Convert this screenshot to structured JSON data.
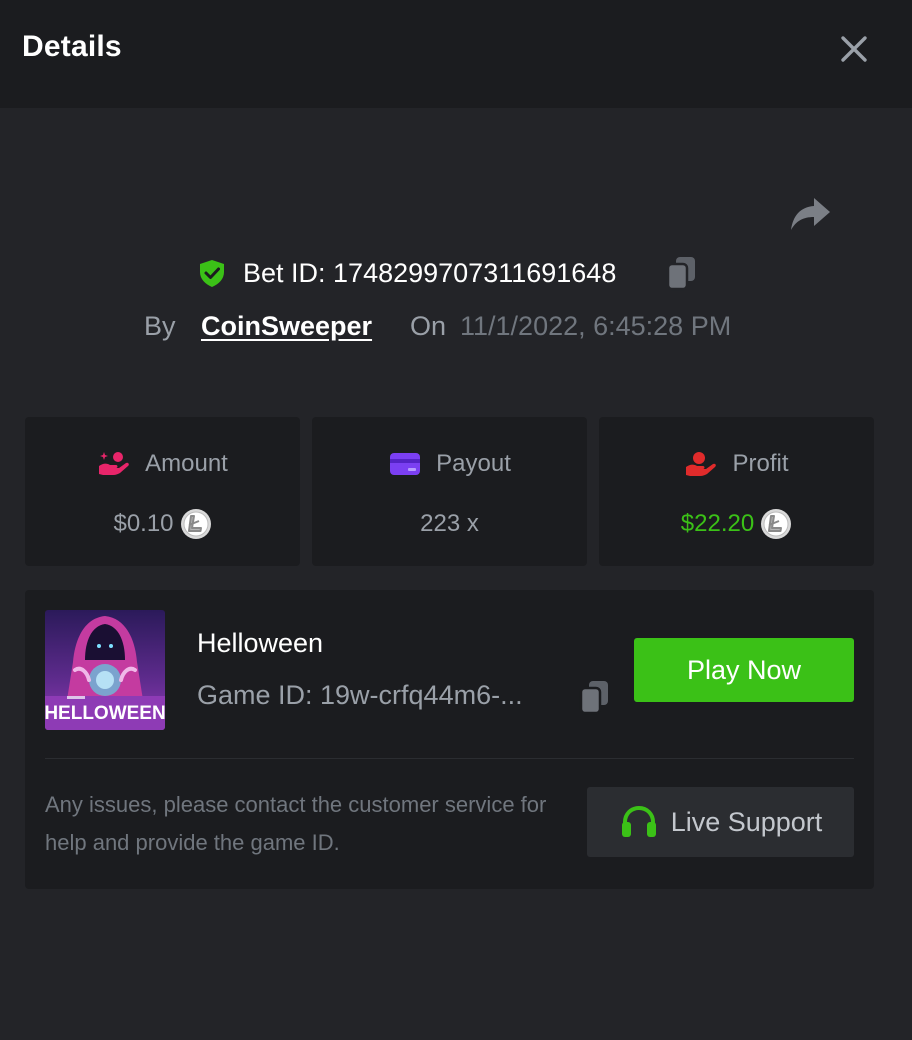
{
  "header": {
    "title": "Details"
  },
  "bet": {
    "id_text": "Bet ID: 1748299707311691648",
    "by_label": "By",
    "username": "CoinSweeper",
    "on_label": "On",
    "date": "11/1/2022, 6:45:28 PM"
  },
  "stats": [
    {
      "label": "Amount",
      "value": "$0.10",
      "icon": "hand-coins-icon",
      "icon_color": "#e8256a",
      "coin": "litecoin"
    },
    {
      "label": "Payout",
      "value": "223 x",
      "icon": "card-icon",
      "icon_color": "#7b3ff2"
    },
    {
      "label": "Profit",
      "value": "$22.20",
      "icon": "hand-heart-icon",
      "icon_color": "#e02b2b",
      "value_color": "#3bc117",
      "coin": "litecoin"
    }
  ],
  "game": {
    "name": "Helloween",
    "id_text": "Game ID: 19w-crfq44m6-...",
    "thumb_text": "HELLOWEEN",
    "play_label": "Play Now",
    "help_text": "Any issues, please contact the customer service for help and provide the game ID.",
    "support_label": "Live Support"
  },
  "colors": {
    "accent_green": "#3bc117",
    "background": "#232428",
    "panel": "#1b1c1f"
  }
}
